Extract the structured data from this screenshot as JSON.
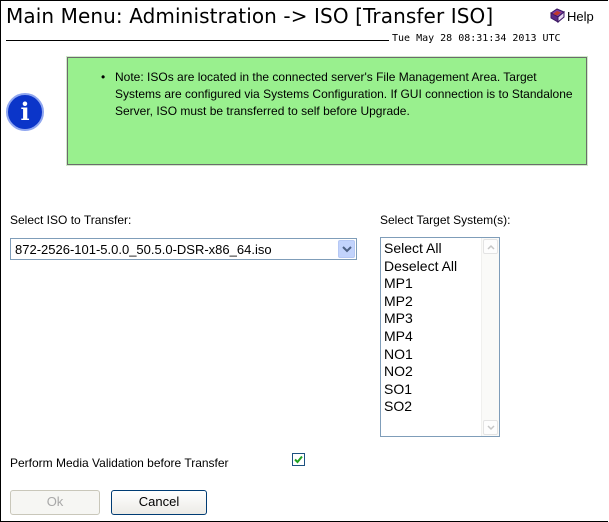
{
  "header": {
    "title": "Main Menu: Administration -> ISO [Transfer ISO]",
    "help_label": "Help",
    "timestamp": "Tue May 28 08:31:34 2013 UTC"
  },
  "note": {
    "text": "Note: ISOs are located in the connected server's File Management Area. Target Systems are configured via Systems Configuration. If GUI connection is to Standalone Server, ISO must be transferred to self before Upgrade."
  },
  "form": {
    "iso_label": "Select ISO to Transfer:",
    "iso_selected": "872-2526-101-5.0.0_50.5.0-DSR-x86_64.iso",
    "target_label": "Select Target System(s):",
    "targets": [
      "Select All",
      "Deselect All",
      "MP1",
      "MP2",
      "MP3",
      "MP4",
      "NO1",
      "NO2",
      "SO1",
      "SO2"
    ],
    "validation_label": "Perform Media Validation before Transfer",
    "validation_checked": true
  },
  "buttons": {
    "ok_label": "Ok",
    "cancel_label": "Cancel"
  },
  "colors": {
    "note_background": "#99f08e",
    "info_icon": "#0b35c9"
  },
  "icons": {
    "help": "help-book-icon",
    "info": "info-icon"
  }
}
